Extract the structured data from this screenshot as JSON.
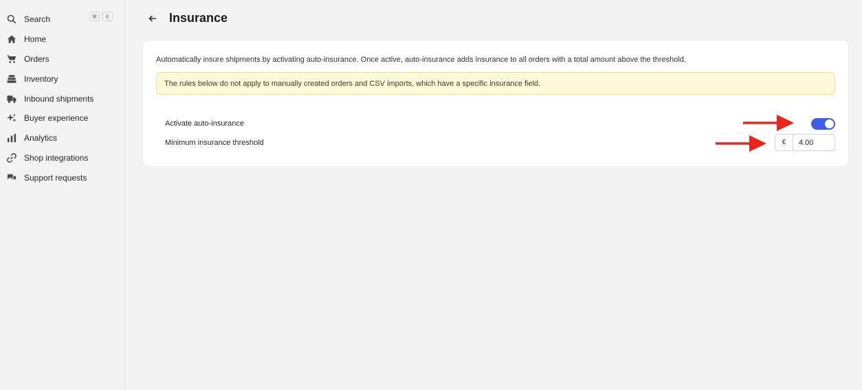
{
  "sidebar": {
    "search": {
      "label": "Search",
      "shortcut_keys": [
        "⌘",
        "K"
      ]
    },
    "items": [
      {
        "label": "Home",
        "icon": "home-icon"
      },
      {
        "label": "Orders",
        "icon": "cart-icon"
      },
      {
        "label": "Inventory",
        "icon": "inventory-icon"
      },
      {
        "label": "Inbound shipments",
        "icon": "truck-icon"
      },
      {
        "label": "Buyer experience",
        "icon": "sparkle-icon"
      },
      {
        "label": "Analytics",
        "icon": "bar-chart-icon"
      },
      {
        "label": "Shop integrations",
        "icon": "link-icon"
      },
      {
        "label": "Support requests",
        "icon": "chat-icon"
      }
    ]
  },
  "header": {
    "title": "Insurance"
  },
  "card": {
    "description": "Automatically insure shipments by activating auto-insurance. Once active, auto-insurance adds insurance to all orders with a total amount above the threshold.",
    "notice": "The rules below do not apply to manually created orders and CSV imports, which have a specific insurance field.",
    "auto_insurance": {
      "label": "Activate auto-insurance",
      "enabled": true
    },
    "threshold": {
      "label": "Minimum insurance threshold",
      "currency": "€",
      "value": "4.00"
    }
  },
  "colors": {
    "accent": "#3e5ce6",
    "annotation_arrow": "#e8271a",
    "notice_bg": "#fff8d9"
  }
}
